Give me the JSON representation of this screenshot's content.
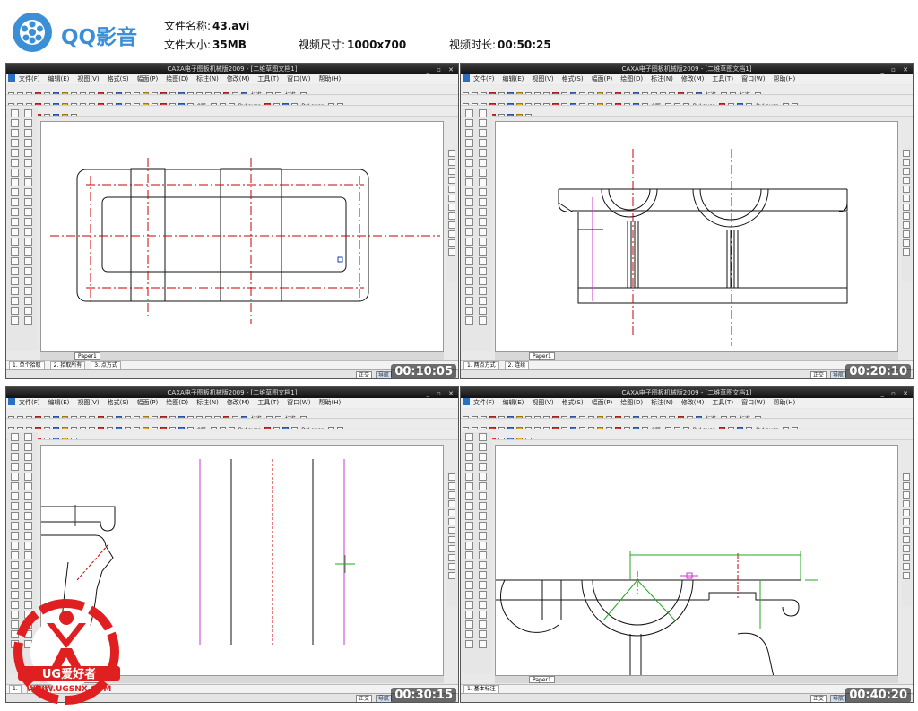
{
  "header": {
    "logo_text": "QQ影音",
    "file_name_label": "文件名称:",
    "file_name": "43.avi",
    "file_size_label": "文件大小:",
    "file_size": "35MB",
    "video_dims_label": "视频尺寸:",
    "video_dims": "1000x700",
    "duration_label": "视频时长:",
    "duration": "00:50:25"
  },
  "app": {
    "window_title": "CAXA电子图板机械版2009 - [二维草图文档1]",
    "menu": [
      "文件(F)",
      "编辑(E)",
      "视图(V)",
      "格式(S)",
      "幅面(P)",
      "绘图(D)",
      "标注(N)",
      "修改(M)",
      "工具(T)",
      "窗口(W)",
      "帮助(H)"
    ],
    "toolbar_labels": {
      "style1": "标准",
      "style2": "标准",
      "layer": "0层",
      "line1": "ByLayer",
      "line2": "ByLayer",
      "linetype": "ByLayer"
    },
    "layout_tab": "Paper1"
  },
  "panels": [
    {
      "timestamp": "00:10:05",
      "cmd_items": [
        "1. 单个拾取",
        "2. 拾取所有",
        "3. 点方式"
      ],
      "status_left": "",
      "status_mid": "",
      "status_coord": ""
    },
    {
      "timestamp": "00:20:10",
      "cmd_items": [
        "1. 两点方式",
        "2. 连续"
      ],
      "status_left": "",
      "status_mid": "",
      "status_coord": ""
    },
    {
      "timestamp": "00:30:15",
      "cmd_items": [
        "1.",
        "2. 连续"
      ],
      "status_left": "",
      "status_mid": "",
      "status_coord": ""
    },
    {
      "timestamp": "00:40:20",
      "cmd_items": [
        "1. 基本标注"
      ],
      "status_left": "",
      "status_mid": "",
      "status_coord": ""
    }
  ],
  "status_modes": [
    "正交",
    "导航"
  ],
  "watermark": {
    "brand": "UG爱好者",
    "url": "WWW.UGSNX.COM"
  },
  "colors": {
    "logo_blue": "#3a8fd6",
    "centerline_red": "#cc0000",
    "construct_magenta": "#cc33cc",
    "dimension_green": "#22aa22",
    "watermark_red": "#e02020"
  }
}
